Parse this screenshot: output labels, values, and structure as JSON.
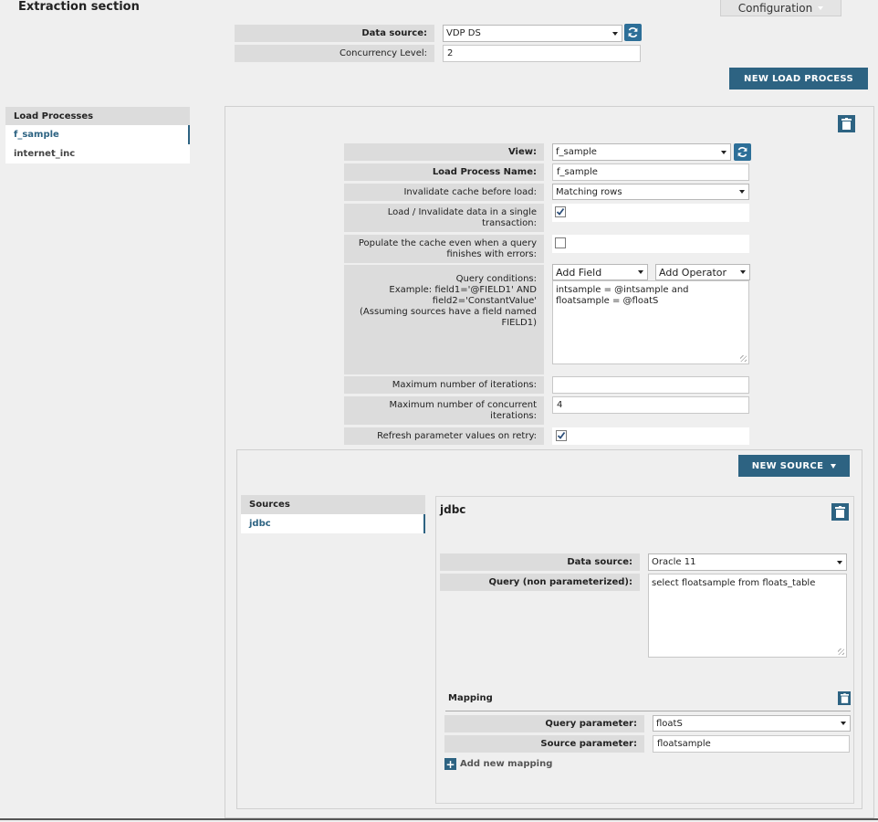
{
  "header": {
    "title": "Extraction section",
    "configuration_label": "Configuration"
  },
  "top_form": {
    "data_source_label": "Data source:",
    "data_source_value": "VDP DS",
    "concurrency_label": "Concurrency Level:",
    "concurrency_value": "2"
  },
  "new_load_process_label": "NEW LOAD PROCESS",
  "load_processes": {
    "header": "Load Processes",
    "items": [
      "f_sample",
      "internet_inc"
    ]
  },
  "load_form": {
    "view_label": "View:",
    "view_value": "f_sample",
    "name_label": "Load Process Name:",
    "name_value": "f_sample",
    "invalidate_label": "Invalidate cache before load:",
    "invalidate_value": "Matching rows",
    "single_tx_label": "Load / Invalidate data in a single transaction:",
    "populate_label": "Populate the cache even when a query finishes with errors:",
    "query_conditions_label": "Query conditions:\nExample: field1='@FIELD1' AND field2='ConstantValue'\n(Assuming sources have a field named FIELD1)",
    "add_field": "Add Field",
    "add_operator": "Add Operator",
    "query_conditions_value": "intsample = @intsample and\nfloatsample = @floatS",
    "max_iter_label": "Maximum number of iterations:",
    "max_iter_value": "",
    "max_concurrent_label": "Maximum number of concurrent iterations:",
    "max_concurrent_value": "4",
    "refresh_label": "Refresh parameter values on retry:"
  },
  "new_source_label": "NEW SOURCE",
  "sources": {
    "header": "Sources",
    "items": [
      "jdbc"
    ]
  },
  "source_detail": {
    "title": "jdbc",
    "data_source_label": "Data source:",
    "data_source_value": "Oracle 11",
    "query_label": "Query (non parameterized):",
    "query_value": "select floatsample from floats_table",
    "mapping_title": "Mapping",
    "query_param_label": "Query parameter:",
    "query_param_value": "floatS",
    "source_param_label": "Source parameter:",
    "source_param_value": "floatsample",
    "add_mapping_label": "Add new mapping"
  },
  "colors": {
    "accent": "#2d6382",
    "background": "#efefef",
    "label_bg": "#dcdcdc"
  }
}
